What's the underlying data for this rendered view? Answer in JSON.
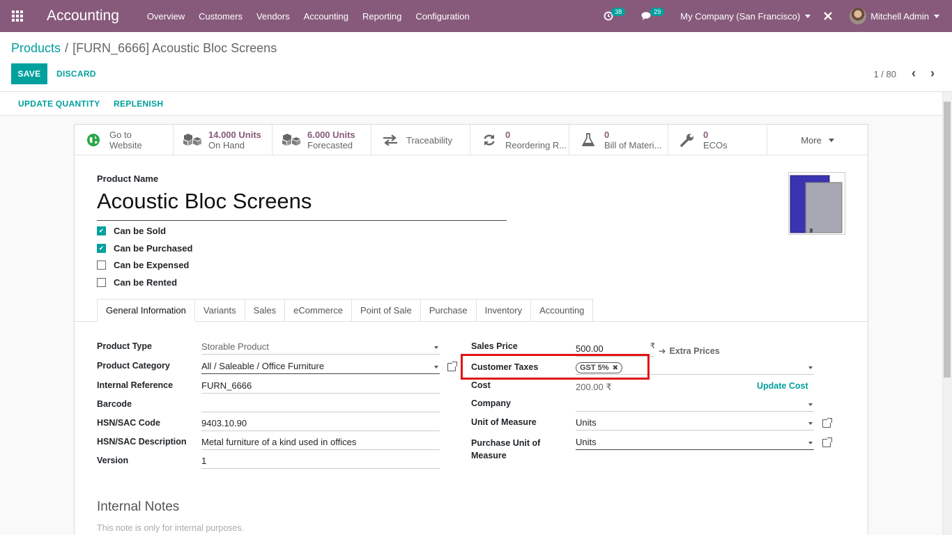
{
  "navbar": {
    "app_title": "Accounting",
    "menu": [
      "Overview",
      "Customers",
      "Vendors",
      "Accounting",
      "Reporting",
      "Configuration"
    ],
    "activity_count": "38",
    "message_count": "29",
    "company": "My Company (San Francisco)",
    "user": "Mitchell Admin",
    "color": "#875a7b"
  },
  "breadcrumb": {
    "parent": "Products",
    "separator": "/",
    "current": "[FURN_6666] Acoustic Bloc Screens"
  },
  "actions": {
    "save": "SAVE",
    "discard": "DISCARD"
  },
  "pager": {
    "value": "1 / 80"
  },
  "statusbar": {
    "update_quantity": "UPDATE QUANTITY",
    "replenish": "REPLENISH"
  },
  "smart_buttons": [
    {
      "icon": "globe-icon",
      "line1": "Go to",
      "line2": "Website"
    },
    {
      "icon": "cubes-icon",
      "line1": "14.000 Units",
      "line2": "On Hand"
    },
    {
      "icon": "cubes-icon",
      "line1": "6.000 Units",
      "line2": "Forecasted"
    },
    {
      "icon": "exchange-icon",
      "line1": "Traceability",
      "line2": ""
    },
    {
      "icon": "refresh-icon",
      "line1": "0",
      "line2": "Reordering R..."
    },
    {
      "icon": "flask-icon",
      "line1": "0",
      "line2": "Bill of Materi..."
    },
    {
      "icon": "wrench-icon",
      "line1": "0",
      "line2": "ECOs"
    },
    {
      "icon": "caret-down-icon",
      "line1": "More",
      "line2": ""
    }
  ],
  "product": {
    "name_label": "Product Name",
    "name": "Acoustic Bloc Screens",
    "checks": [
      {
        "label": "Can be Sold",
        "checked": true
      },
      {
        "label": "Can be Purchased",
        "checked": true
      },
      {
        "label": "Can be Expensed",
        "checked": false
      },
      {
        "label": "Can be Rented",
        "checked": false
      }
    ]
  },
  "tabs": [
    "General Information",
    "Variants",
    "Sales",
    "eCommerce",
    "Point of Sale",
    "Purchase",
    "Inventory",
    "Accounting"
  ],
  "general": {
    "product_type": {
      "label": "Product Type",
      "value": "Storable Product"
    },
    "product_category": {
      "label": "Product Category",
      "value": "All / Saleable / Office Furniture"
    },
    "internal_reference": {
      "label": "Internal Reference",
      "value": "FURN_6666"
    },
    "barcode": {
      "label": "Barcode",
      "value": ""
    },
    "hsn_code": {
      "label": "HSN/SAC Code",
      "value": "9403.10.90"
    },
    "hsn_description": {
      "label": "HSN/SAC Description",
      "value": "Metal furniture of a kind used in offices"
    },
    "version": {
      "label": "Version",
      "value": "1"
    },
    "sales_price": {
      "label": "Sales Price",
      "value": "500.00",
      "currency": "₹",
      "extra": "Extra Prices"
    },
    "customer_taxes": {
      "label": "Customer Taxes",
      "tag": "GST 5%"
    },
    "cost": {
      "label": "Cost",
      "value": "200.00 ₹",
      "action": "Update Cost"
    },
    "company": {
      "label": "Company",
      "value": ""
    },
    "uom": {
      "label": "Unit of Measure",
      "value": "Units"
    },
    "purchase_uom": {
      "label_line1": "Purchase Unit of",
      "label_line2": "Measure",
      "value": "Units"
    }
  },
  "notes": {
    "title": "Internal Notes",
    "placeholder": "This note is only for internal purposes."
  },
  "colors": {
    "accent": "#00a09d",
    "highlight": "#e21414"
  }
}
